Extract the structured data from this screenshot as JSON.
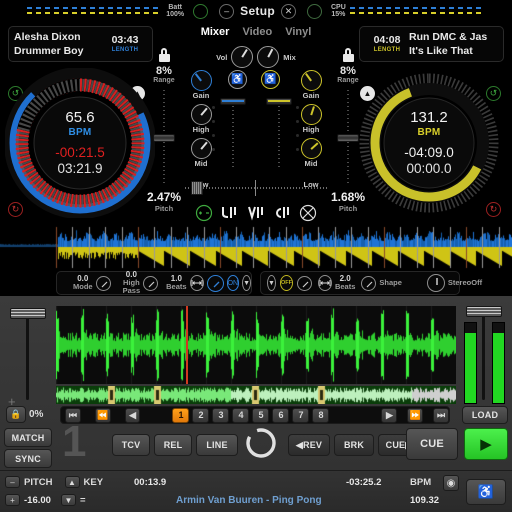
{
  "topbar": {
    "battery_label": "Batt",
    "battery_value": "100%",
    "minimize_icon": "minus-icon",
    "setup_label": "Setup",
    "close_icon": "close-icon",
    "cpu_label": "CPU",
    "cpu_value": "15%",
    "deck_a_color": "#2d7fd6",
    "deck_b_color": "#d8cf2a"
  },
  "deck_a": {
    "artist": "Alesha Dixon",
    "title": "Drummer Boy",
    "length": "03:43",
    "length_caption": "LENGTH",
    "bpm": "65.6",
    "bpm_label": "BPM",
    "remaining": "-00:21.5",
    "elapsed": "03:21.9",
    "range": "8%",
    "range_label": "Range",
    "pitch": "2.47%",
    "pitch_label": "Pitch",
    "lock_icon": "lock-icon",
    "loop_icon": "loop-icon",
    "eject_icon": "eject-icon",
    "ring_color": "#1f6fd0",
    "ticks_color": "#d81f1f"
  },
  "deck_b": {
    "artist": "Run DMC & Jas",
    "title": "It's Like That",
    "length": "04:08",
    "length_caption": "LENGTH",
    "bpm": "131.2",
    "bpm_label": "BPM",
    "remaining": "-04:09.0",
    "elapsed": "00:00.0",
    "range": "8%",
    "range_label": "Range",
    "pitch": "1.68%",
    "pitch_label": "Pitch",
    "lock_icon": "lock-icon",
    "loop_icon": "loop-icon",
    "loop_icon_2": "loop-reverse-icon",
    "eject_icon": "eject-icon",
    "ring_color": "#c9c12a"
  },
  "mixer": {
    "tabs": [
      {
        "label": "Mixer",
        "active": true
      },
      {
        "label": "Video",
        "active": false
      },
      {
        "label": "Vinyl",
        "active": false
      }
    ],
    "vol_label": "Vol",
    "mix_label": "Mix",
    "cue_icon_a": "headphone-icon",
    "cue_icon_b": "headphone-icon",
    "eq_a": {
      "gain": "Gain",
      "high": "High",
      "mid": "Mid",
      "low": "Low"
    },
    "eq_b": {
      "gain": "Gain",
      "high": "High",
      "mid": "Mid",
      "low": "Low"
    },
    "fx_icons": [
      "plus-minus-icon",
      "fx-filter-icon",
      "fx-gater-icon",
      "fx-reverse-icon",
      "fx-off-icon"
    ]
  },
  "fx_left": {
    "mode_value": "0.0",
    "mode_label": "Mode",
    "highpass_value": "0.0",
    "highpass_label": "High Pass",
    "beats_value": "1.0",
    "beats_label": "Beats",
    "beat_icon": "beatgrid-icon",
    "knob_icon": "knob-icon",
    "on_label": "ON",
    "expand_icon": "chevron-down-icon"
  },
  "fx_right": {
    "expand_icon": "chevron-down-icon",
    "off_label": "OFF",
    "knob_icon": "knob-icon",
    "beat_icon": "beatgrid-icon",
    "beats_value": "2.0",
    "beats_label": "Beats",
    "shape_label": "Shape",
    "stereo_label": "StereoOff",
    "stereo_icon": "stereo-knob-icon"
  },
  "bottom_deck": {
    "deck_number": "1",
    "lock_icon": "lock-icon",
    "lock_value": "0%",
    "match_label": "MATCH",
    "sync_label": "SYNC",
    "transport": [
      {
        "name": "skip-start-icon",
        "glyph": "◀▐"
      },
      {
        "name": "rewind-icon",
        "glyph": "◀◀"
      },
      {
        "name": "step-back-icon",
        "glyph": "◀"
      }
    ],
    "beats": [
      "1",
      "2",
      "3",
      "4",
      "5",
      "6",
      "7",
      "8"
    ],
    "active_beat": "1",
    "transport_right": [
      {
        "name": "step-forward-icon",
        "glyph": "▶"
      },
      {
        "name": "fast-forward-icon",
        "glyph": "▶▶"
      },
      {
        "name": "skip-end-icon",
        "glyph": "▶▶▶"
      }
    ],
    "load_label": "LOAD",
    "jog_icon": "jog-wheel-icon",
    "tcv_label": "TCV",
    "rel_label": "REL",
    "line_label": "LINE",
    "rev_label": "◀REV",
    "brk_label": "BRK",
    "cue_fwd_label": "CUE▶",
    "cue_label": "CUE",
    "play_icon": "play-icon"
  },
  "statusbar": {
    "pitch_minus_icon": "minus-icon",
    "pitch_label": "PITCH",
    "pitch_value": "-16.00",
    "pitch_plus_icon": "plus-icon",
    "key_up_icon": "triangle-up-icon",
    "key_label": "KEY",
    "key_down_icon": "triangle-down-icon",
    "key_value": "=",
    "elapsed": "00:13.9",
    "remaining": "-03:25.2",
    "bpm_label": "BPM",
    "bpm_value": "109.32",
    "track": "Armin Van Buuren - Ping Pong",
    "record_icon": "record-icon",
    "headphone_icon": "headphone-icon"
  }
}
